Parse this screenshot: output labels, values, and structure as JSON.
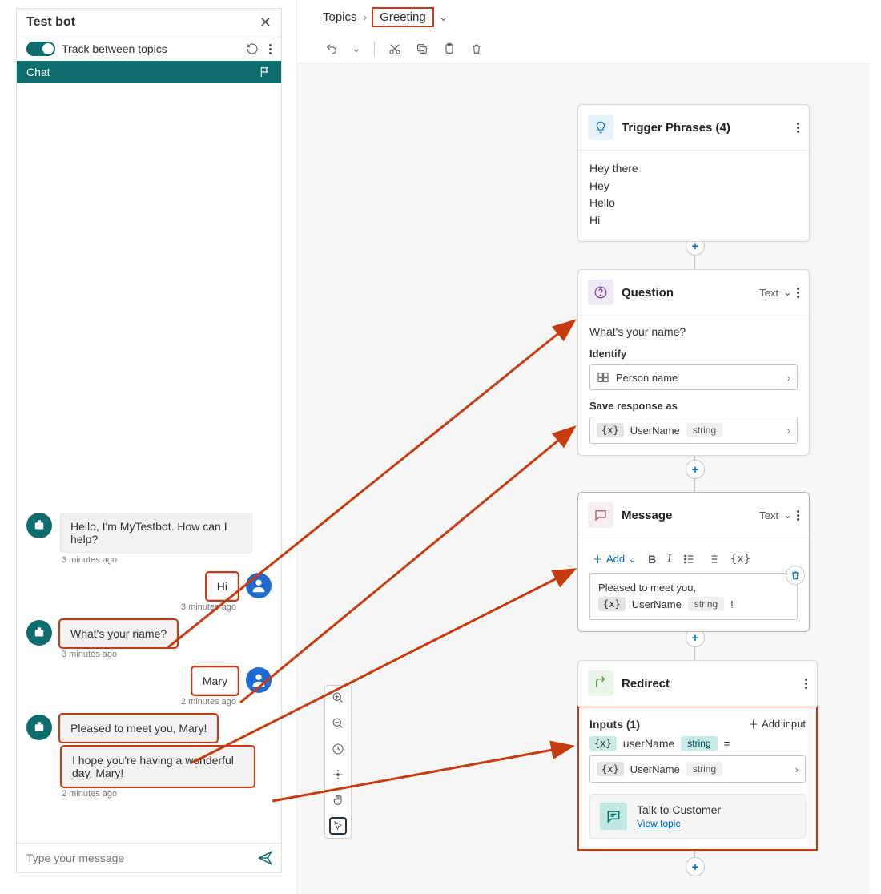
{
  "left": {
    "title": "Test bot",
    "track_label": "Track between topics",
    "chat_tab": "Chat",
    "messages": {
      "bot_intro": "Hello, I'm MyTestbot. How can I help?",
      "bot_intro_time": "3 minutes ago",
      "user_hi": "Hi",
      "user_hi_time": "3 minutes ago",
      "bot_ask_name": "What's your name?",
      "bot_ask_name_time": "3 minutes ago",
      "user_name": "Mary",
      "user_name_time": "2 minutes ago",
      "bot_pleased": "Pleased to meet you, Mary!",
      "bot_day": "I hope you're having a wonderful day, Mary!",
      "bot_day_time": "2 minutes ago"
    },
    "input_placeholder": "Type your message"
  },
  "breadcrumb": {
    "root": "Topics",
    "current": "Greeting"
  },
  "nodes": {
    "trigger": {
      "title": "Trigger Phrases (4)",
      "phrases": [
        "Hey there",
        "Hey",
        "Hello",
        "Hi"
      ]
    },
    "question": {
      "title": "Question",
      "meta": "Text",
      "text": "What's your name?",
      "identify_label": "Identify",
      "identify_value": "Person name",
      "save_label": "Save response as",
      "var_name": "UserName",
      "var_type": "string"
    },
    "message": {
      "title": "Message",
      "meta": "Text",
      "add_label": "Add",
      "text": "Pleased to meet you,",
      "var_name": "UserName",
      "var_type": "string",
      "trailing": "!"
    },
    "redirect": {
      "title": "Redirect",
      "inputs_label": "Inputs (1)",
      "add_input": "Add input",
      "param_name": "userName",
      "param_type": "string",
      "eq": "=",
      "value_name": "UserName",
      "value_type": "string",
      "talk_title": "Talk to Customer",
      "talk_link": "View topic"
    }
  },
  "colors": {
    "highlight": "#c83b0e",
    "teal": "#0d6d6d",
    "blue": "#1f6bd4"
  }
}
